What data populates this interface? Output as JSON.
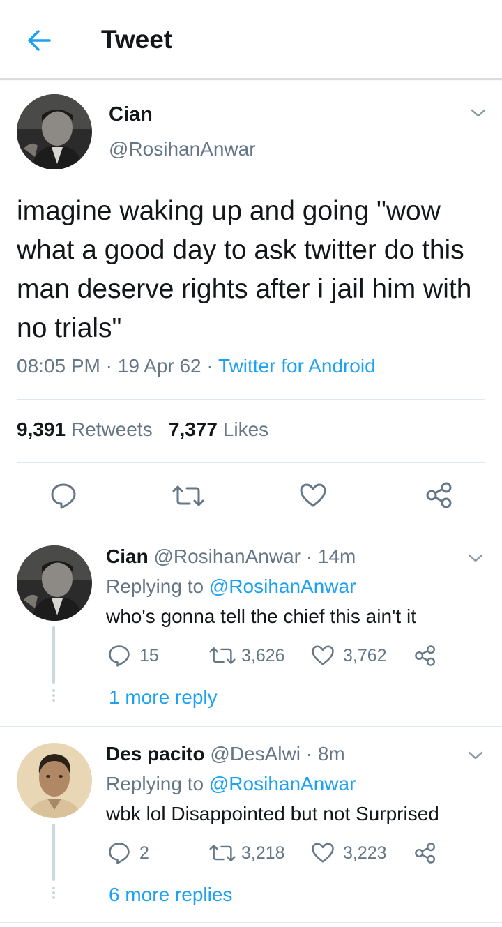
{
  "header": {
    "title": "Tweet"
  },
  "main_tweet": {
    "name": "Cian",
    "handle": "@RosihanAnwar",
    "text": "imagine waking up and going \"wow what a good day to ask twitter do this man deserve rights after i jail him with no trials\"",
    "time": "08:05 PM",
    "date": "19 Apr 62",
    "source": "Twitter for Android",
    "retweets": "9,391",
    "retweets_label": "Retweets",
    "likes": "7,377",
    "likes_label": "Likes"
  },
  "replies": [
    {
      "name": "Cian",
      "handle": "@RosihanAnwar",
      "age": "14m",
      "replying_prefix": "Replying to",
      "replying_to": "@RosihanAnwar",
      "text": "who's gonna tell the chief this ain't it",
      "reply_count": "15",
      "retweet_count": "3,626",
      "like_count": "3,762",
      "more_label": "1 more reply"
    },
    {
      "name": "Des pacito",
      "handle": "@DesAlwi",
      "age": "8m",
      "replying_prefix": "Replying to",
      "replying_to": "@RosihanAnwar",
      "text": "wbk lol Disappointed but not Surprised",
      "reply_count": "2",
      "retweet_count": "3,218",
      "like_count": "3,223",
      "more_label": "6 more replies"
    }
  ],
  "colors": {
    "accent": "#1da1f2",
    "secondary_text": "#657786",
    "divider": "#e1e8ed"
  },
  "icons": [
    "back-arrow-icon",
    "chevron-down-icon",
    "reply-icon",
    "retweet-icon",
    "like-icon",
    "share-icon"
  ]
}
